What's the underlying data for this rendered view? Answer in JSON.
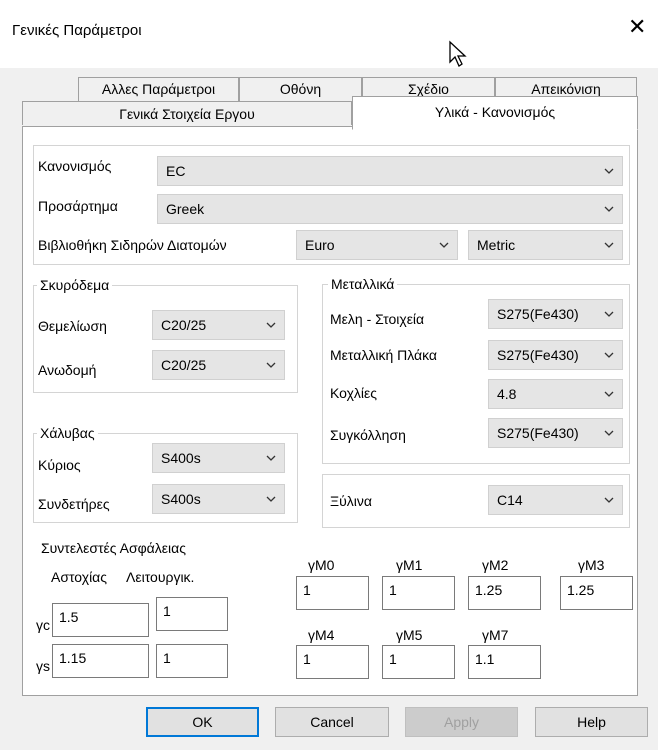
{
  "window": {
    "title": "Γενικές Παράμετροι"
  },
  "tabs": {
    "row1": [
      "Αλλες Παράμετροι",
      "Οθόνη",
      "Σχέδιο",
      "Απεικόνιση"
    ],
    "row2": [
      "Γενικά Στοιχεία Εργου",
      "Υλικά - Κανονισμός"
    ],
    "active": "Υλικά - Κανονισμός"
  },
  "general": {
    "code_label": "Κανονισμός",
    "code_value": "EC",
    "annex_label": "Προσάρτημα",
    "annex_value": "Greek",
    "steel_lib_label": "Βιβλιοθήκη Σιδηρών Διατομών",
    "steel_lib_value": "Euro",
    "units_value": "Metric"
  },
  "concrete": {
    "title": "Σκυρόδεμα",
    "foundation_label": "Θεμελίωση",
    "foundation_value": "C20/25",
    "superstructure_label": "Ανωδομή",
    "superstructure_value": "C20/25"
  },
  "rebar": {
    "title": "Χάλυβας",
    "main_label": "Κύριος",
    "main_value": "S400s",
    "stirrups_label": "Συνδετήρες",
    "stirrups_value": "S400s"
  },
  "metals": {
    "title": "Μεταλλικά",
    "members_label": "Μελη - Στοιχεία",
    "members_value": "S275(Fe430)",
    "plate_label": "Μεταλλική Πλάκα",
    "plate_value": "S275(Fe430)",
    "bolts_label": "Κοχλίες",
    "bolts_value": "4.8",
    "welding_label": "Συγκόλληση",
    "welding_value": "S275(Fe430)"
  },
  "timber": {
    "label": "Ξύλινα",
    "value": "C14"
  },
  "safety": {
    "title": "Συντελεστές Ασφάλειας",
    "col_failure": "Αστοχίας",
    "col_service": "Λειτουργικ.",
    "gc_label": "γc",
    "gc_failure": "1.5",
    "gc_service": "1",
    "gs_label": "γs",
    "gs_failure": "1.15",
    "gs_service": "1",
    "gm0_label": "γM0",
    "gm0": "1",
    "gm1_label": "γM1",
    "gm1": "1",
    "gm2_label": "γM2",
    "gm2": "1.25",
    "gm3_label": "γM3",
    "gm3": "1.25",
    "gm4_label": "γM4",
    "gm4": "1",
    "gm5_label": "γM5",
    "gm5": "1",
    "gm7_label": "γM7",
    "gm7": "1.1"
  },
  "buttons": {
    "ok": "OK",
    "cancel": "Cancel",
    "apply": "Apply",
    "help": "Help"
  }
}
